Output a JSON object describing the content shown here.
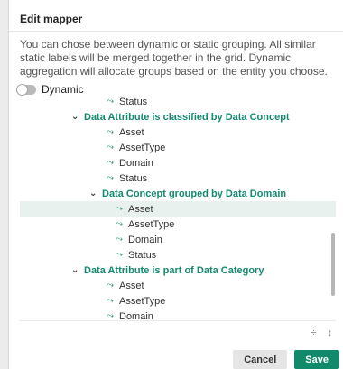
{
  "dialog": {
    "title": "Edit mapper",
    "description": "You can chose between dynamic or static grouping. All similar static labels will be merged together in the grid. Dynamic aggregation will allocate groups based on the entity you choose."
  },
  "toggle": {
    "label": "Dynamic",
    "on": false
  },
  "tree": {
    "rows": [
      {
        "kind": "leaf",
        "indent": "leaf1",
        "label": "Status"
      },
      {
        "kind": "group",
        "indent": "group",
        "label": "Data Attribute is classified by Data Concept"
      },
      {
        "kind": "leaf",
        "indent": "leaf1",
        "label": "Asset"
      },
      {
        "kind": "leaf",
        "indent": "leaf1",
        "label": "AssetType"
      },
      {
        "kind": "leaf",
        "indent": "leaf1",
        "label": "Domain"
      },
      {
        "kind": "leaf",
        "indent": "leaf1",
        "label": "Status"
      },
      {
        "kind": "group",
        "indent": "group2",
        "label": "Data Concept grouped by Data Domain"
      },
      {
        "kind": "leaf",
        "indent": "leaf2",
        "label": "Asset",
        "selected": true
      },
      {
        "kind": "leaf",
        "indent": "leaf2",
        "label": "AssetType"
      },
      {
        "kind": "leaf",
        "indent": "leaf2",
        "label": "Domain"
      },
      {
        "kind": "leaf",
        "indent": "leaf2",
        "label": "Status"
      },
      {
        "kind": "group",
        "indent": "group",
        "label": "Data Attribute is part of Data Category"
      },
      {
        "kind": "leaf",
        "indent": "leaf1",
        "label": "Asset"
      },
      {
        "kind": "leaf",
        "indent": "leaf1",
        "label": "AssetType"
      },
      {
        "kind": "leaf",
        "indent": "leaf1",
        "label": "Domain"
      }
    ]
  },
  "icons": {
    "leaf": "trend-icon",
    "group": "chevron-down-icon",
    "tools": [
      "collapse-icon",
      "expand-icon"
    ]
  },
  "colors": {
    "accent": "#118a6c",
    "selected_bg": "#e9f1ee"
  },
  "footer": {
    "cancel_label": "Cancel",
    "save_label": "Save"
  }
}
